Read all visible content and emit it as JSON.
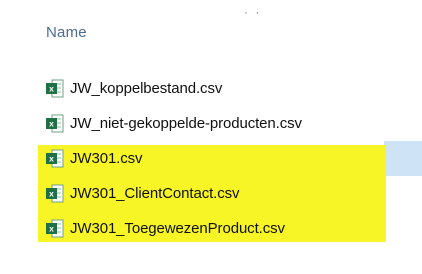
{
  "header": {
    "name_column": "Name",
    "dots": "· ·"
  },
  "files": [
    {
      "name": "JW_koppelbestand.csv",
      "icon": "excel-csv-icon",
      "highlighted": false,
      "selected": false
    },
    {
      "name": "JW_niet-gekoppelde-producten.csv",
      "icon": "excel-csv-icon",
      "highlighted": false,
      "selected": false
    },
    {
      "name": "JW301.csv",
      "icon": "excel-csv-icon",
      "highlighted": true,
      "selected": true
    },
    {
      "name": "JW301_ClientContact.csv",
      "icon": "excel-csv-icon",
      "highlighted": true,
      "selected": false
    },
    {
      "name": "JW301_ToegewezenProduct.csv",
      "icon": "excel-csv-icon",
      "highlighted": true,
      "selected": false
    }
  ],
  "colors": {
    "highlight": "#f7f526",
    "selection": "#cfe3f7",
    "excel_green": "#1e7145",
    "header_text": "#4a6b8c"
  }
}
